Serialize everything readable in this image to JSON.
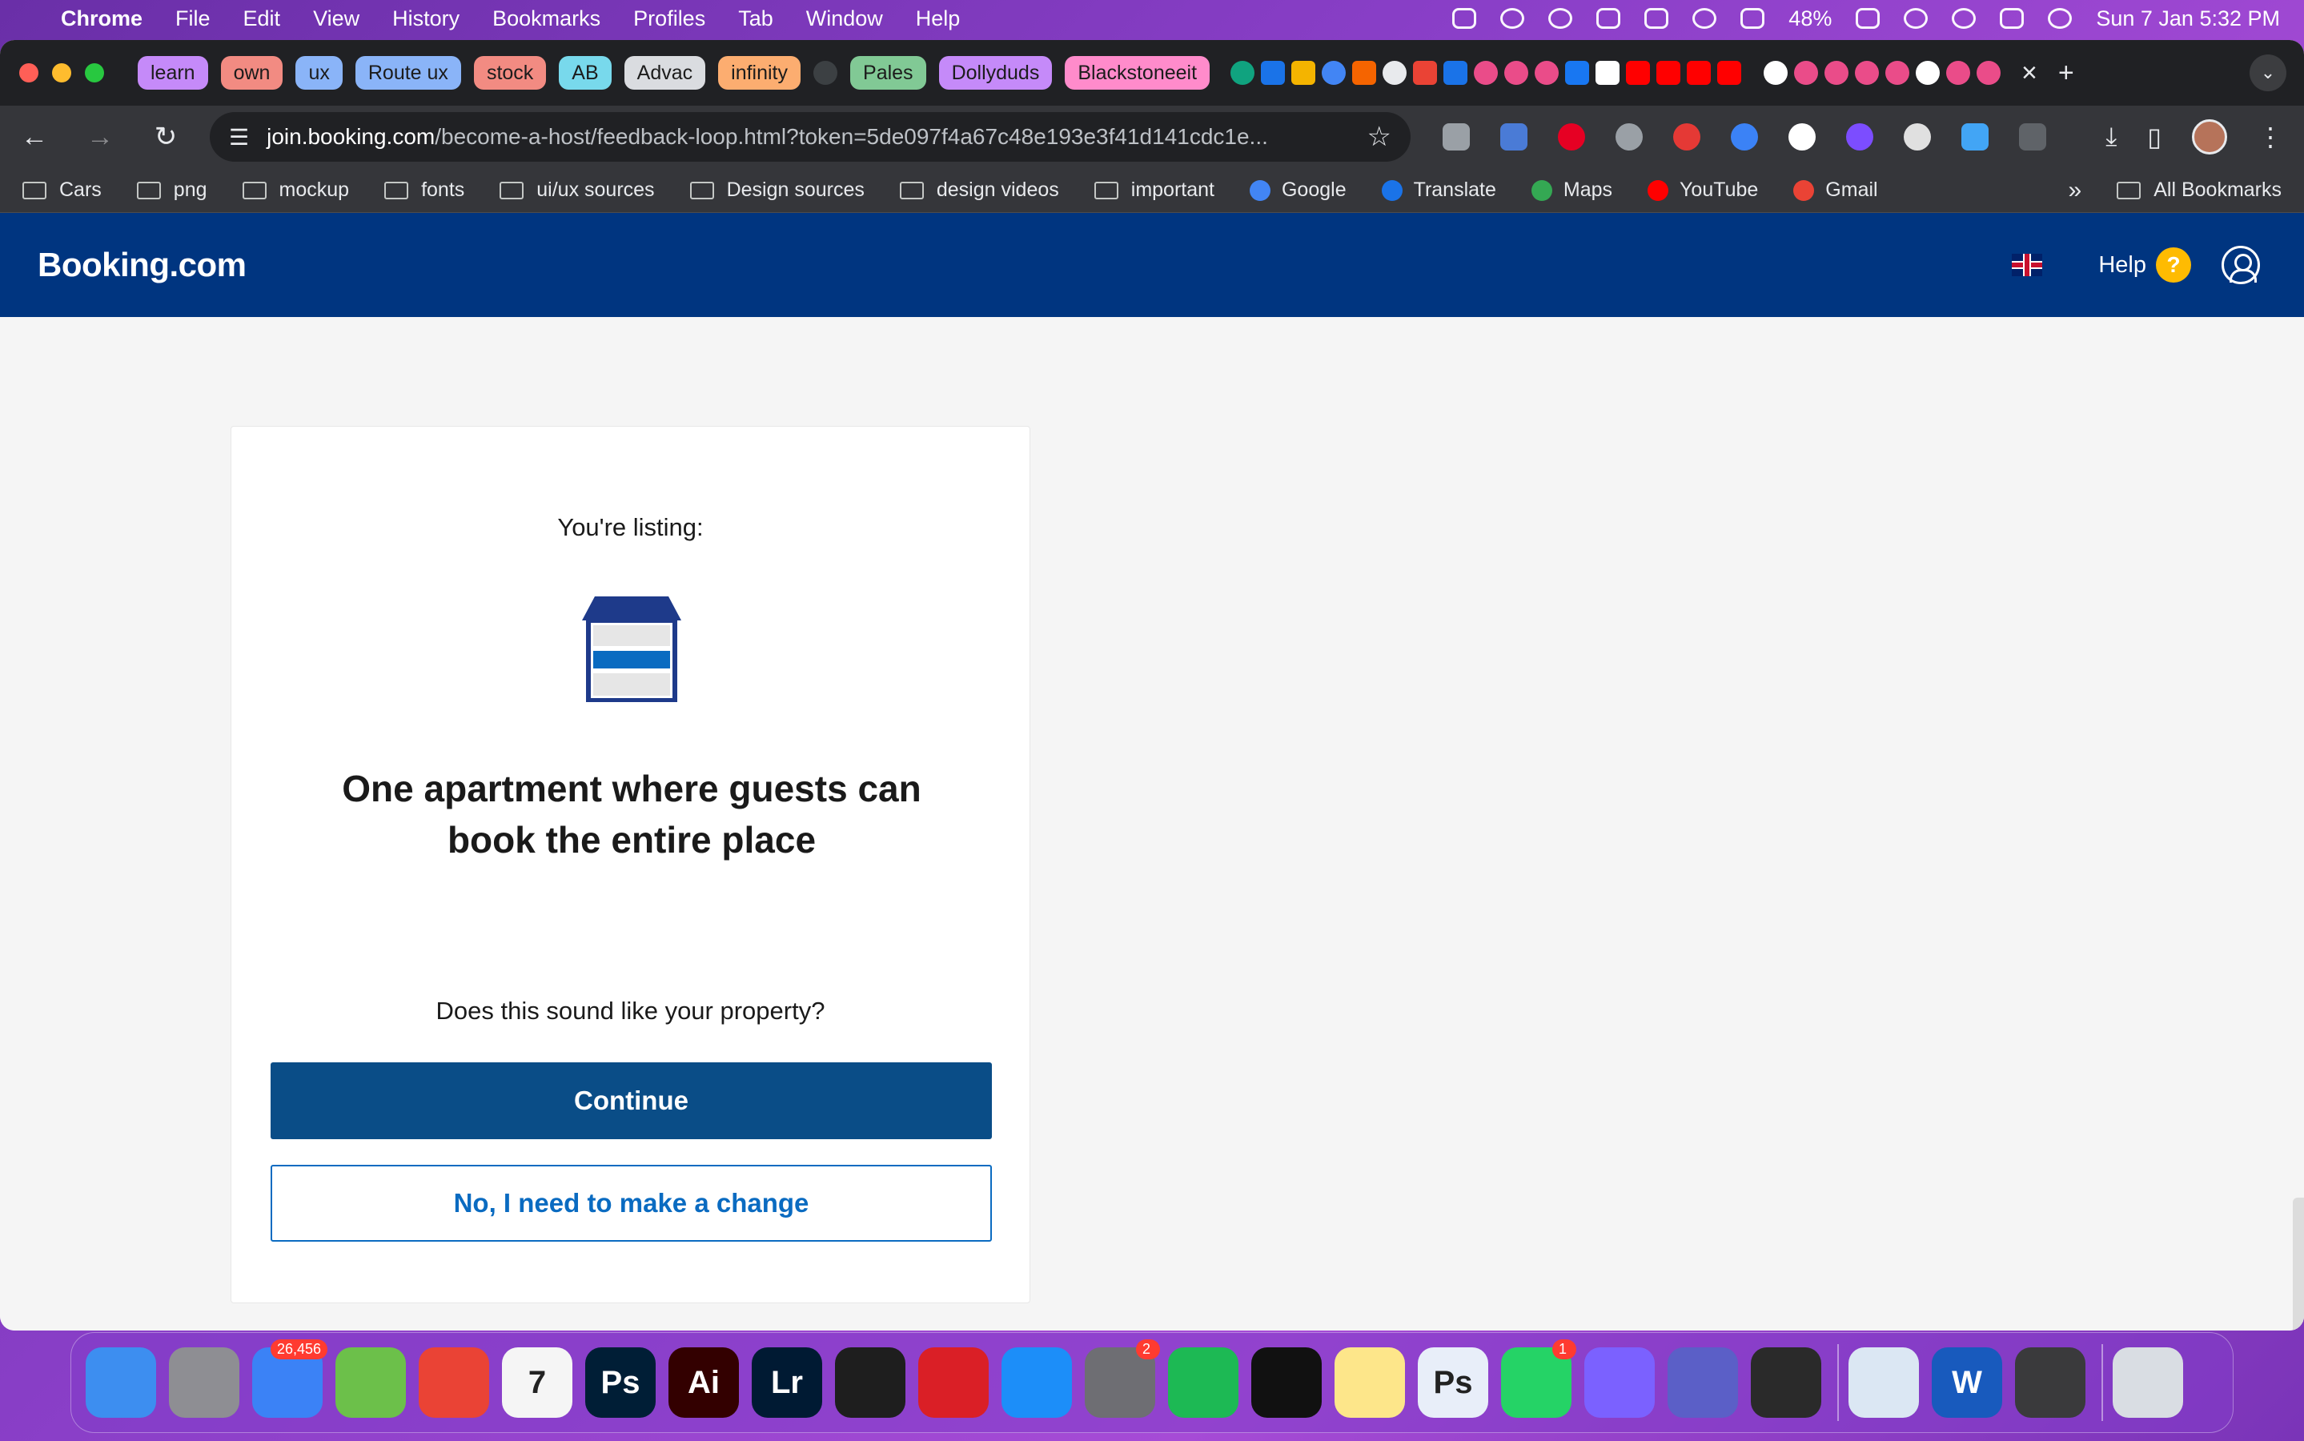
{
  "menubar": {
    "app": "Chrome",
    "items": [
      "File",
      "Edit",
      "View",
      "History",
      "Bookmarks",
      "Profiles",
      "Tab",
      "Window",
      "Help"
    ],
    "battery": "48%",
    "datetime": "Sun 7 Jan  5:32 PM"
  },
  "tabs": {
    "groups": [
      {
        "label": "learn",
        "color": "#c58af9"
      },
      {
        "label": "own",
        "color": "#f28b82"
      },
      {
        "label": "ux",
        "color": "#8ab4f8"
      },
      {
        "label": "Route ux",
        "color": "#8ab4f8"
      },
      {
        "label": "stock",
        "color": "#f28b82"
      },
      {
        "label": "AB",
        "color": "#78d9ec"
      },
      {
        "label": "Advac",
        "color": "#dadce0"
      },
      {
        "label": "infinity",
        "color": "#fcad70"
      },
      {
        "label": "Pales",
        "color": "#81c995"
      },
      {
        "label": "Dollyduds",
        "color": "#c58af9"
      },
      {
        "label": "Blackstoneeit",
        "color": "#ff8bcb"
      }
    ],
    "close_icon": "×",
    "new_tab_icon": "+"
  },
  "address": {
    "host": "join.booking.com",
    "path": "/become-a-host/feedback-loop.html?token=5de097f4a67c48e193e3f41d141cdc1e..."
  },
  "bookmarks": {
    "items": [
      {
        "label": "Cars",
        "type": "folder"
      },
      {
        "label": "png",
        "type": "folder"
      },
      {
        "label": "mockup",
        "type": "folder"
      },
      {
        "label": "fonts",
        "type": "folder"
      },
      {
        "label": "ui/ux sources",
        "type": "folder"
      },
      {
        "label": "Design sources",
        "type": "folder"
      },
      {
        "label": "design videos",
        "type": "folder"
      },
      {
        "label": "important",
        "type": "folder"
      },
      {
        "label": "Google",
        "type": "link",
        "color": "#4285f4"
      },
      {
        "label": "Translate",
        "type": "link",
        "color": "#1a73e8"
      },
      {
        "label": "Maps",
        "type": "link",
        "color": "#34a853"
      },
      {
        "label": "YouTube",
        "type": "link",
        "color": "#ff0000"
      },
      {
        "label": "Gmail",
        "type": "link",
        "color": "#ea4335"
      }
    ],
    "more": "»",
    "all": "All Bookmarks"
  },
  "site": {
    "logo": "Booking.com",
    "help": "Help",
    "help_icon": "?",
    "brand_color": "#003580"
  },
  "card": {
    "lead": "You're listing:",
    "headline": "One apartment where guests can book the entire place",
    "question": "Does this sound like your property?",
    "continue": "Continue",
    "change": "No, I need to make a change"
  },
  "dock": {
    "apps": [
      {
        "name": "finder-icon",
        "label": "",
        "color": "#3d8ef0"
      },
      {
        "name": "launchpad-icon",
        "label": "",
        "color": "#8e8e93"
      },
      {
        "name": "mail-icon",
        "label": "",
        "color": "#3b82f6",
        "badge": "26,456"
      },
      {
        "name": "maps-icon",
        "label": "",
        "color": "#6cc04a"
      },
      {
        "name": "chrome-icon",
        "label": "",
        "color": "#ea4335"
      },
      {
        "name": "calendar-icon",
        "label": "7",
        "color": "#f5f5f5"
      },
      {
        "name": "photoshop-icon",
        "label": "Ps",
        "color": "#001e36"
      },
      {
        "name": "illustrator-icon",
        "label": "Ai",
        "color": "#330000"
      },
      {
        "name": "lightroom-icon",
        "label": "Lr",
        "color": "#001a33"
      },
      {
        "name": "figma-icon",
        "label": "",
        "color": "#1e1e1e"
      },
      {
        "name": "creative-cloud-icon",
        "label": "",
        "color": "#da1f26"
      },
      {
        "name": "app-store-icon",
        "label": "",
        "color": "#1c8ef9"
      },
      {
        "name": "system-settings-icon",
        "label": "",
        "color": "#6e6e73",
        "badge": "2"
      },
      {
        "name": "spotify-icon",
        "label": "",
        "color": "#1db954"
      },
      {
        "name": "arc-icon",
        "label": "",
        "color": "#111111"
      },
      {
        "name": "notes-icon",
        "label": "",
        "color": "#fde68a"
      },
      {
        "name": "photoshop-alt-icon",
        "label": "Ps",
        "color": "#e8eef9"
      },
      {
        "name": "whatsapp-icon",
        "label": "",
        "color": "#25d366",
        "badge": "1"
      },
      {
        "name": "framer-icon",
        "label": "",
        "color": "#7b61ff"
      },
      {
        "name": "teams-icon",
        "label": "",
        "color": "#5b5fc7"
      },
      {
        "name": "quicktime-icon",
        "label": "",
        "color": "#2a2a2a"
      }
    ],
    "apps_right": [
      {
        "name": "preview-icon",
        "label": "",
        "color": "#dbe7f3"
      },
      {
        "name": "word-icon",
        "label": "W",
        "color": "#185abd"
      },
      {
        "name": "calculator-icon",
        "label": "",
        "color": "#3a3a3c"
      }
    ],
    "trash": {
      "name": "trash-icon",
      "label": "",
      "color": "#d9dde3"
    }
  }
}
